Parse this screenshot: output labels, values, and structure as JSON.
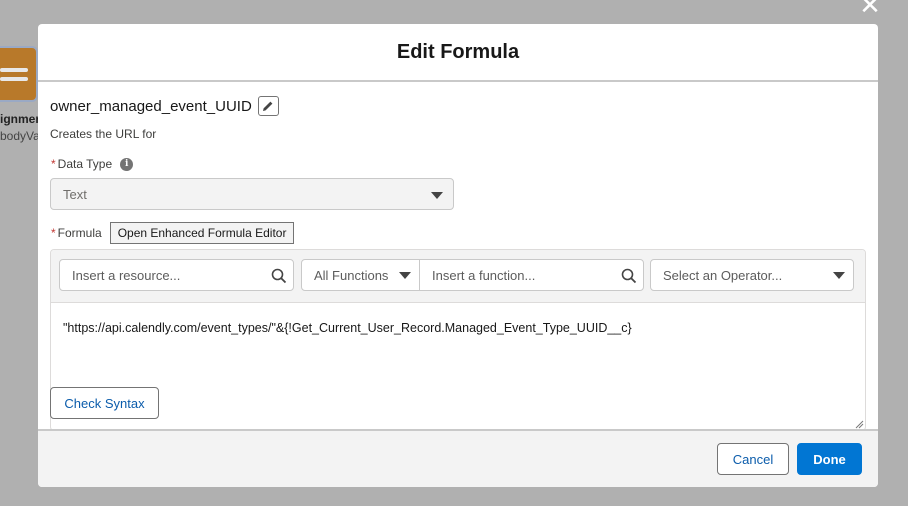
{
  "background": {
    "node_label": "ignmer",
    "node_sublabel": "bodyVal"
  },
  "modal": {
    "title": "Edit Formula",
    "api_name": "owner_managed_event_UUID",
    "description": "Creates the URL for",
    "data_type": {
      "label": "Data Type",
      "required_marker": "*",
      "value": "Text"
    },
    "formula": {
      "label": "Formula",
      "required_marker": "*",
      "enhanced_editor_button": "Open Enhanced Formula Editor",
      "resource_placeholder": "Insert a resource...",
      "function_category": "All Functions",
      "function_placeholder": "Insert a function...",
      "operator_placeholder": "Select an Operator...",
      "text": "\"https://api.calendly.com/event_types/\"&{!Get_Current_User_Record.Managed_Event_Type_UUID__c}"
    },
    "check_syntax_label": "Check Syntax",
    "footer": {
      "cancel_label": "Cancel",
      "done_label": "Done"
    }
  },
  "colors": {
    "brand": "#0176d3",
    "link": "#0b5cab",
    "required": "#c23934"
  }
}
